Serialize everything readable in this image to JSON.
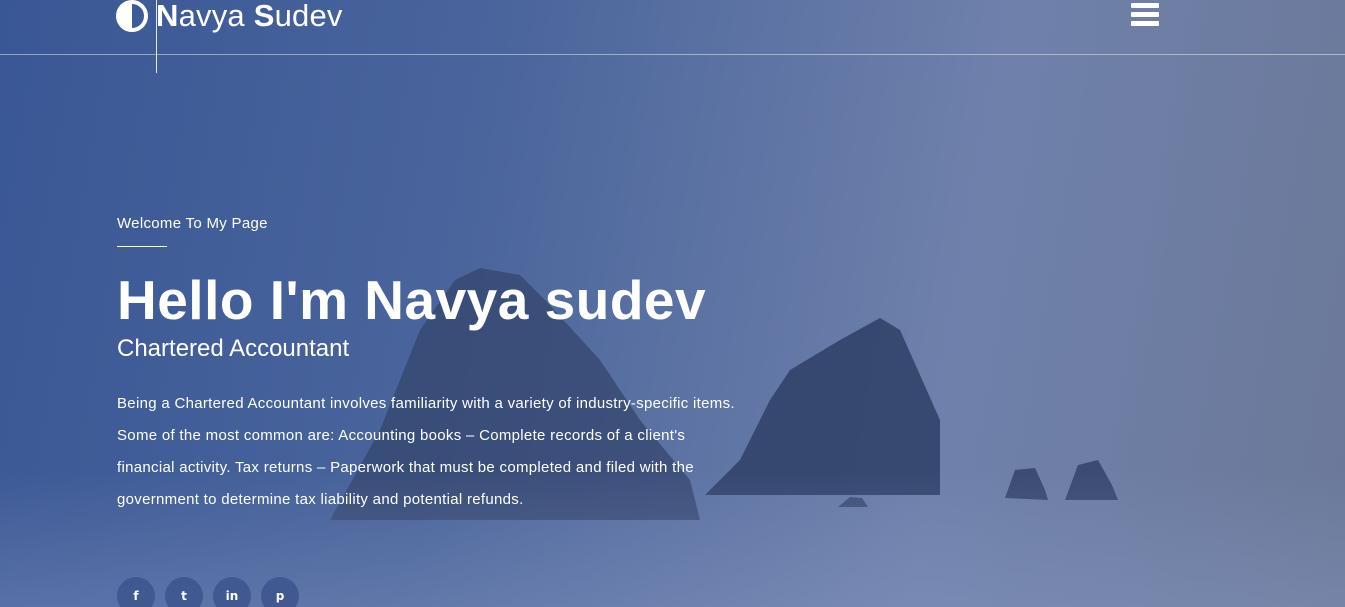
{
  "brand": {
    "name_first_initial": "N",
    "name_first_rest": "avya ",
    "name_last_initial": "S",
    "name_last_rest": "udev",
    "icon": "half-circle-icon"
  },
  "nav": {
    "menu_icon": "hamburger-menu-icon"
  },
  "hero": {
    "welcome": "Welcome To My Page",
    "title": "Hello I'm Navya sudev",
    "subtitle": "Chartered Accountant",
    "description": "Being a Chartered Accountant involves familiarity with a variety of industry-specific items. Some of the most common are: Accounting books – Complete records of a client's financial activity. Tax returns – Paperwork that must be completed and filed with the government to determine tax liability and potential refunds."
  },
  "social": [
    {
      "glyph": "f",
      "icon": "facebook-icon"
    },
    {
      "glyph": "t",
      "icon": "twitter-icon"
    },
    {
      "glyph": "in",
      "icon": "linkedin-icon"
    },
    {
      "glyph": "p",
      "icon": "pinterest-icon"
    }
  ],
  "colors": {
    "overlay_start": "#3a5795",
    "overlay_end": "#6b7898",
    "rock": "#34456e"
  }
}
